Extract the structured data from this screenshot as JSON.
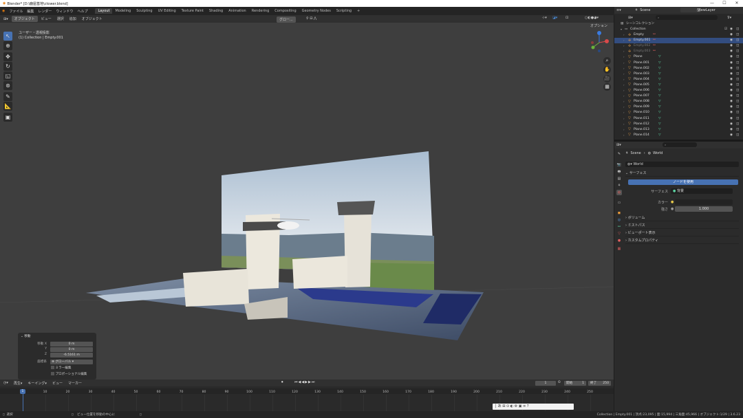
{
  "app": {
    "title": "Blender* [D:\\鹿屋基地\\ctower.blend]",
    "win_min": "—",
    "win_max": "☐",
    "win_close": "✕"
  },
  "menu": [
    "ファイル",
    "編集",
    "レンダー",
    "ウィンドウ",
    "ヘルプ"
  ],
  "workspaces": [
    "Layout",
    "Modeling",
    "Sculpting",
    "UV Editing",
    "Texture Paint",
    "Shading",
    "Animation",
    "Rendering",
    "Compositing",
    "Geometry Nodes",
    "Scripting"
  ],
  "workspace_add": "+",
  "viewport": {
    "mode": "オブジェクト",
    "menus": [
      "ビュー",
      "選択",
      "追加",
      "オブジェクト"
    ],
    "transform": "グロー...",
    "view_label": "ユーザー・透視投影",
    "collection_label": "(1) Collection | Empty.001",
    "options": "オプション"
  },
  "operator_panel": {
    "title": "移動",
    "rows": [
      {
        "label": "移動 X",
        "value": "0 m"
      },
      {
        "label": "Y",
        "value": "0 m"
      },
      {
        "label": "Z",
        "value": "-6.5161 m"
      }
    ],
    "orient_label": "座標系",
    "orient_value": "グローバル",
    "check1": "ミラー編集",
    "check2": "プロポーショナル編集"
  },
  "timeline": {
    "menus": [
      "再生",
      "キーイング",
      "ビュー",
      "マーカー"
    ],
    "current_frame": "1",
    "start_label": "開始",
    "start": "1",
    "end_label": "終了",
    "end": "250",
    "ticks": [
      "0",
      "10",
      "20",
      "30",
      "40",
      "50",
      "60",
      "70",
      "80",
      "90",
      "100",
      "110",
      "120",
      "130",
      "140",
      "150",
      "160",
      "170",
      "180",
      "190",
      "200",
      "210",
      "220",
      "230",
      "240",
      "250"
    ],
    "playhead": "1"
  },
  "statusbar": {
    "left": "選択",
    "middle": "ビュー位置を移動の中心に",
    "right": "Collection | Empty.001 | 頂点:23,095 | 面:15,994 | 三角面:45,966 | オブジェクト:1/29 | 3.6.23"
  },
  "outliner": {
    "scene": "Scene",
    "viewlayer": "ViewLayer",
    "root": "シーンコレクション",
    "collection": "Collection",
    "items": [
      {
        "name": "Empty",
        "type": "empty"
      },
      {
        "name": "Empty.001",
        "type": "empty",
        "selected": true
      },
      {
        "name": "Empty.002",
        "type": "empty",
        "dim": true
      },
      {
        "name": "Empty.003",
        "type": "empty",
        "dim": true
      },
      {
        "name": "Plane",
        "type": "mesh"
      },
      {
        "name": "Plane.001",
        "type": "mesh"
      },
      {
        "name": "Plane.002",
        "type": "mesh"
      },
      {
        "name": "Plane.003",
        "type": "mesh"
      },
      {
        "name": "Plane.004",
        "type": "mesh"
      },
      {
        "name": "Plane.005",
        "type": "mesh"
      },
      {
        "name": "Plane.006",
        "type": "mesh"
      },
      {
        "name": "Plane.007",
        "type": "mesh"
      },
      {
        "name": "Plane.008",
        "type": "mesh"
      },
      {
        "name": "Plane.009",
        "type": "mesh"
      },
      {
        "name": "Plane.010",
        "type": "mesh"
      },
      {
        "name": "Plane.011",
        "type": "mesh"
      },
      {
        "name": "Plane.012",
        "type": "mesh"
      },
      {
        "name": "Plane.013",
        "type": "mesh"
      },
      {
        "name": "Plane.014",
        "type": "mesh"
      }
    ]
  },
  "properties": {
    "breadcrumb_scene": "Scene",
    "breadcrumb_world": "World",
    "world_name": "World",
    "surface_section": "サーフェス",
    "use_nodes": "ノードを使用",
    "surface_label": "サーフェス",
    "surface_value": "背景",
    "color_label": "カラー",
    "strength_label": "強さ",
    "strength_value": "1.000",
    "sections": [
      "ボリューム",
      "ミストパス",
      "ビューポート表示",
      "カスタムプロパティ"
    ]
  },
  "colors": {
    "accent": "#4772b3",
    "selected": "#334d80",
    "empty": "#e8a04a",
    "mesh": "#e8a04a",
    "modifier": "#5bd0a0"
  }
}
